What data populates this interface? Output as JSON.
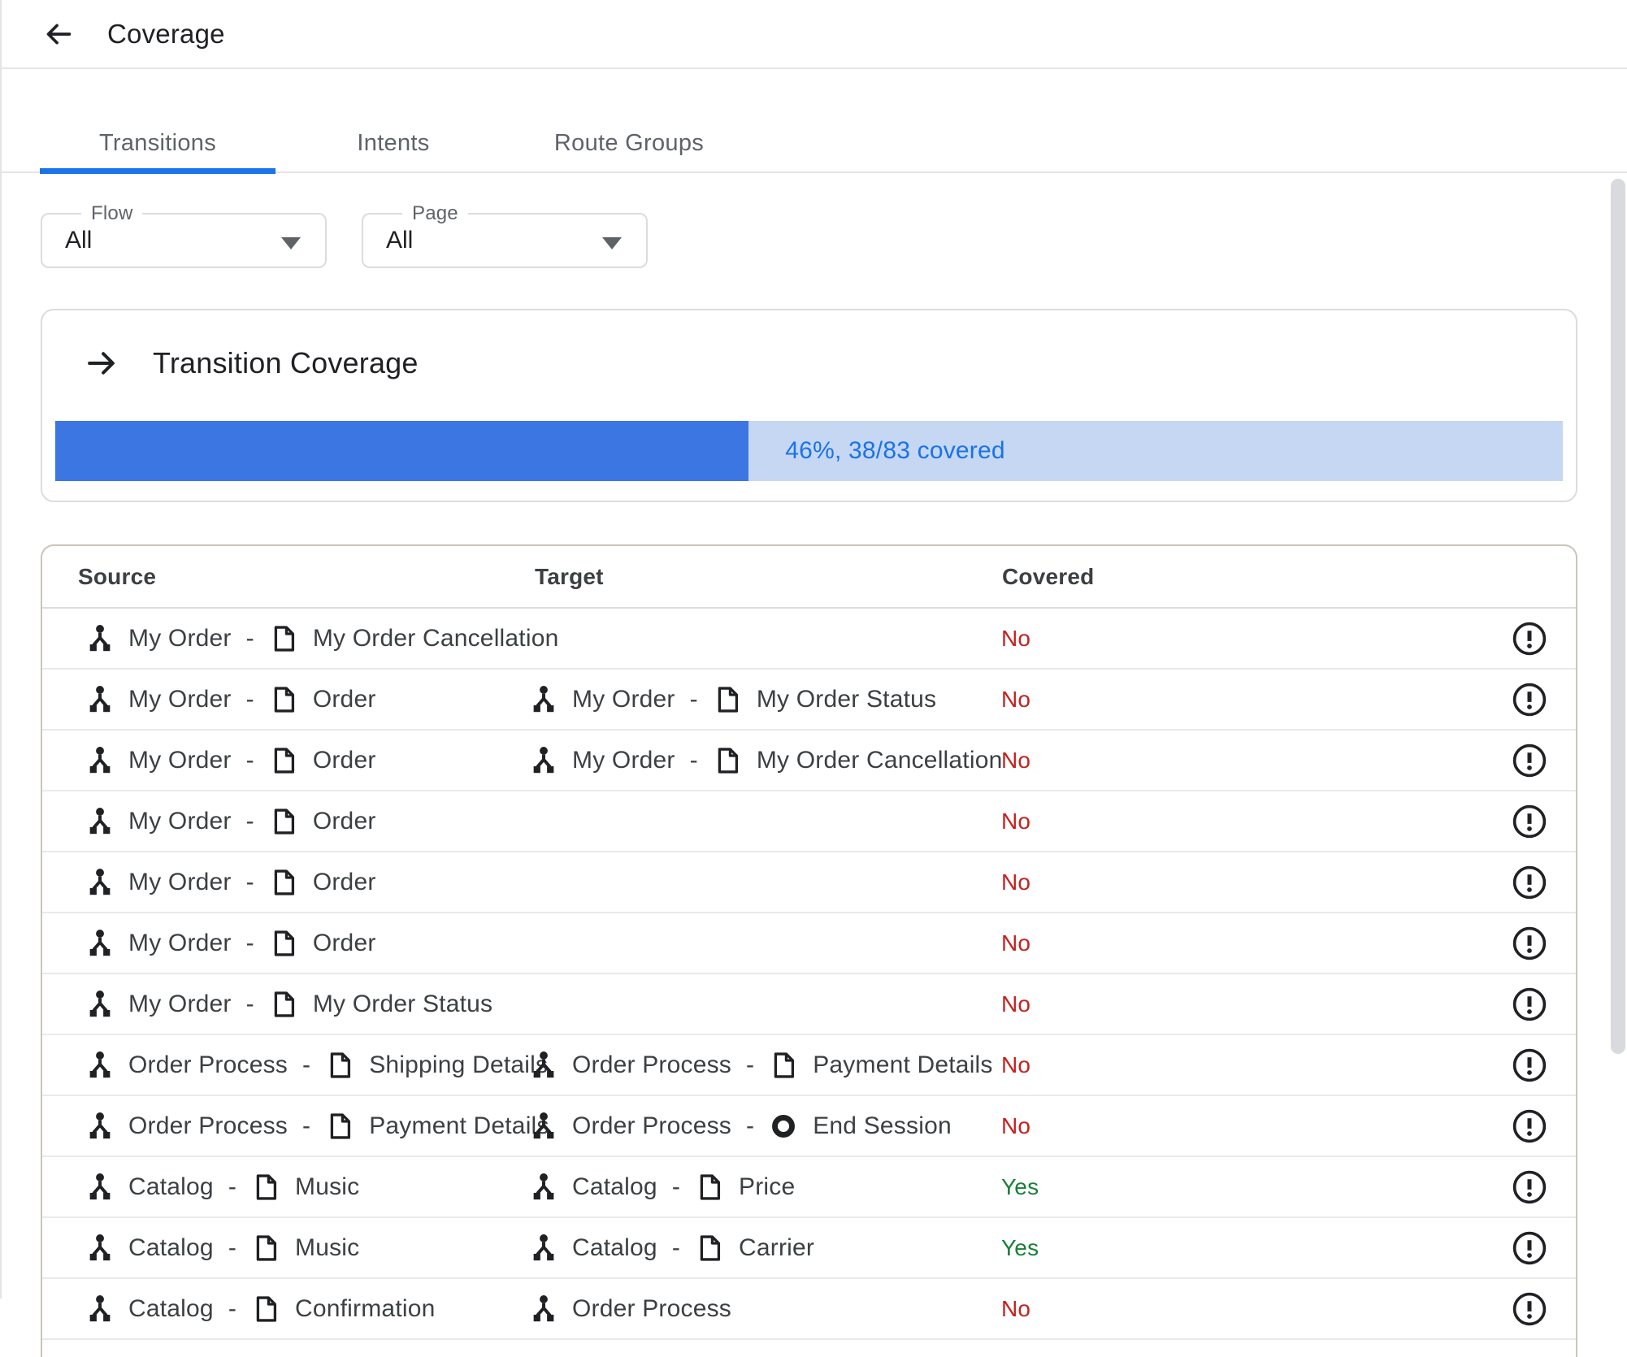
{
  "header": {
    "title": "Coverage",
    "back_icon": "arrow-back"
  },
  "tabs": [
    {
      "label": "Transitions",
      "active": true
    },
    {
      "label": "Intents",
      "active": false
    },
    {
      "label": "Route Groups",
      "active": false
    }
  ],
  "filters": [
    {
      "label": "Flow",
      "value": "All"
    },
    {
      "label": "Page",
      "value": "All"
    }
  ],
  "coverage_card": {
    "title": "Transition Coverage",
    "percent": 46,
    "label": "46%, 38/83 covered"
  },
  "table": {
    "columns": [
      "Source",
      "Target",
      "Covered"
    ],
    "rows": [
      {
        "source": {
          "flow": "My Order",
          "page": "My Order Cancellation"
        },
        "target": null,
        "covered": "No"
      },
      {
        "source": {
          "flow": "My Order",
          "page": "Order"
        },
        "target": {
          "flow": "My Order",
          "page": "My Order Status"
        },
        "covered": "No"
      },
      {
        "source": {
          "flow": "My Order",
          "page": "Order"
        },
        "target": {
          "flow": "My Order",
          "page": "My Order Cancellation"
        },
        "covered": "No"
      },
      {
        "source": {
          "flow": "My Order",
          "page": "Order"
        },
        "target": null,
        "covered": "No"
      },
      {
        "source": {
          "flow": "My Order",
          "page": "Order"
        },
        "target": null,
        "covered": "No"
      },
      {
        "source": {
          "flow": "My Order",
          "page": "Order"
        },
        "target": null,
        "covered": "No"
      },
      {
        "source": {
          "flow": "My Order",
          "page": "My Order Status"
        },
        "target": null,
        "covered": "No"
      },
      {
        "source": {
          "flow": "Order Process",
          "page": "Shipping Details"
        },
        "target": {
          "flow": "Order Process",
          "page": "Payment Details"
        },
        "covered": "No"
      },
      {
        "source": {
          "flow": "Order Process",
          "page": "Payment Details"
        },
        "target": {
          "flow": "Order Process",
          "page": "End Session",
          "page_icon": "end-session"
        },
        "covered": "No"
      },
      {
        "source": {
          "flow": "Catalog",
          "page": "Music"
        },
        "target": {
          "flow": "Catalog",
          "page": "Price"
        },
        "covered": "Yes"
      },
      {
        "source": {
          "flow": "Catalog",
          "page": "Music"
        },
        "target": {
          "flow": "Catalog",
          "page": "Carrier"
        },
        "covered": "Yes"
      },
      {
        "source": {
          "flow": "Catalog",
          "page": "Confirmation"
        },
        "target": {
          "flow": "Order Process",
          "page": null
        },
        "covered": "No"
      }
    ]
  },
  "ui": {
    "dash_separator": "-"
  },
  "colors": {
    "accent_blue": "#1a73e8",
    "progress_fill": "#3b76e3",
    "progress_track": "#c6d7f4",
    "covered_no": "#c5221f",
    "covered_yes": "#188038"
  }
}
